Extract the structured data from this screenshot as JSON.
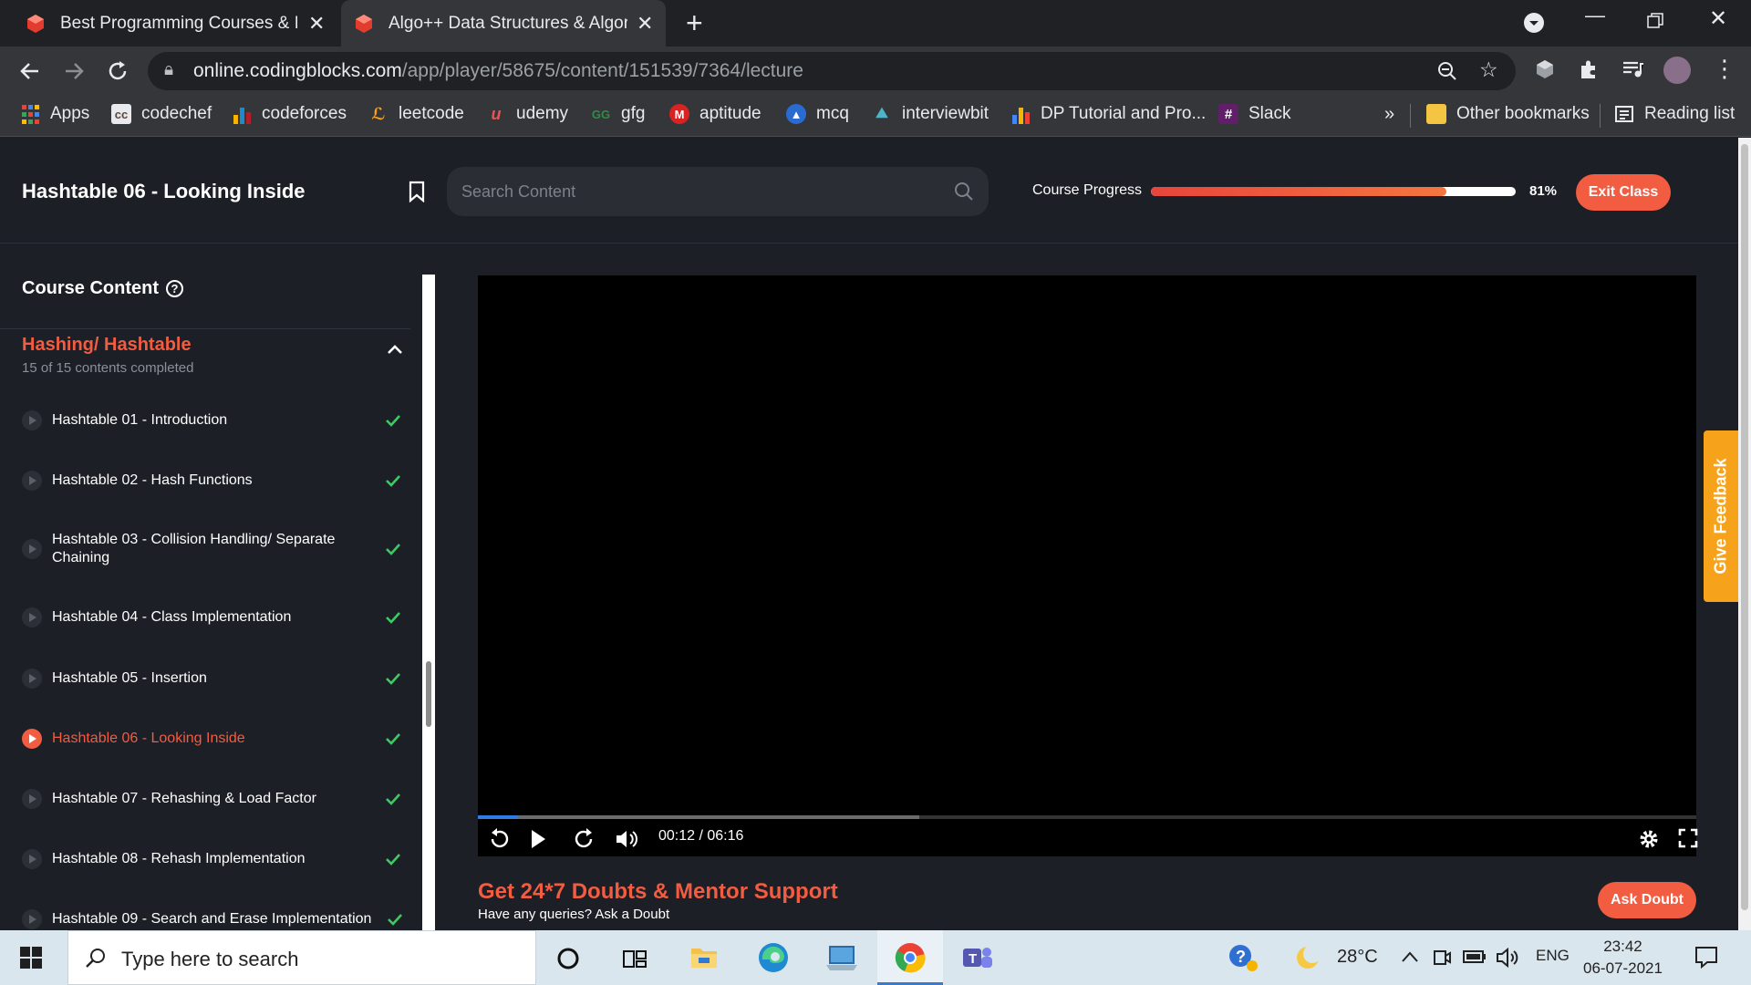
{
  "browser": {
    "tabs": [
      {
        "title": "Best Programming Courses & IT",
        "active": false
      },
      {
        "title": "Algo++ Data Structures & Algori",
        "active": true
      }
    ],
    "url_domain": "online.codingblocks.com",
    "url_path": "/app/player/58675/content/151539/7364/lecture",
    "bookmarks": [
      {
        "label": "Apps",
        "icon": "apps-grid-icon",
        "color": "#4285f4"
      },
      {
        "label": "codechef",
        "icon": "codechef-icon",
        "color": "#5b4638"
      },
      {
        "label": "codeforces",
        "icon": "codeforces-icon",
        "color": "#1f8acb"
      },
      {
        "label": "leetcode",
        "icon": "leetcode-icon",
        "color": "#f89f1b"
      },
      {
        "label": "udemy",
        "icon": "udemy-icon",
        "color": "#ec5252"
      },
      {
        "label": "gfg",
        "icon": "gfg-icon",
        "color": "#2f8d46"
      },
      {
        "label": "aptitude",
        "icon": "aptitude-icon",
        "color": "#d92323"
      },
      {
        "label": "mcq",
        "icon": "mcq-icon",
        "color": "#2a6bd1"
      },
      {
        "label": "interviewbit",
        "icon": "interviewbit-icon",
        "color": "#4fb3c9"
      },
      {
        "label": "DP Tutorial and Pro...",
        "icon": "dp-tutorial-icon",
        "color": "#f4b400"
      },
      {
        "label": "Slack",
        "icon": "slack-icon",
        "color": "#611f69"
      }
    ],
    "more_bookmarks": "»",
    "other_bookmarks": "Other bookmarks",
    "reading_list": "Reading list"
  },
  "header": {
    "lecture_title": "Hashtable 06 - Looking Inside",
    "search_placeholder": "Search Content",
    "progress_label": "Course Progress",
    "progress_value": 0.81,
    "progress_text": "81%",
    "exit_label": "Exit Class"
  },
  "sidebar": {
    "title": "Course Content",
    "help": "?",
    "section": {
      "title": "Hashing/ Hashtable",
      "subtitle": "15 of 15 contents completed"
    },
    "lessons": [
      {
        "name": "Hashtable 01 - Introduction",
        "done": true
      },
      {
        "name": "Hashtable 02 - Hash Functions",
        "done": true
      },
      {
        "name": "Hashtable 03 - Collision Handling/ Separate Chaining",
        "done": true
      },
      {
        "name": "Hashtable 04 - Class Implementation",
        "done": true
      },
      {
        "name": "Hashtable 05 - Insertion",
        "done": true
      },
      {
        "name": "Hashtable 06 - Looking Inside",
        "done": true,
        "current": true
      },
      {
        "name": "Hashtable 07 - Rehashing & Load Factor",
        "done": true
      },
      {
        "name": "Hashtable 08 - Rehash Implementation",
        "done": true
      },
      {
        "name": "Hashtable 09 - Search and Erase Implementation",
        "done": true
      }
    ]
  },
  "player": {
    "time": "00:12 / 06:16",
    "played_fraction": 0.033,
    "loaded_fraction": 0.362
  },
  "doubt": {
    "title": "Get 24*7 Doubts & Mentor Support",
    "subtitle": "Have any queries? Ask a Doubt",
    "button": "Ask Doubt"
  },
  "feedback_label": "Give Feedback",
  "taskbar": {
    "search_placeholder": "Type here to search",
    "temperature": "28°C",
    "language": "ENG",
    "time": "23:42",
    "date": "06-07-2021"
  },
  "colors": {
    "accent": "#f25c40",
    "background": "#1c1f26",
    "check": "#3ccb63",
    "feedback": "#f7a21b"
  }
}
